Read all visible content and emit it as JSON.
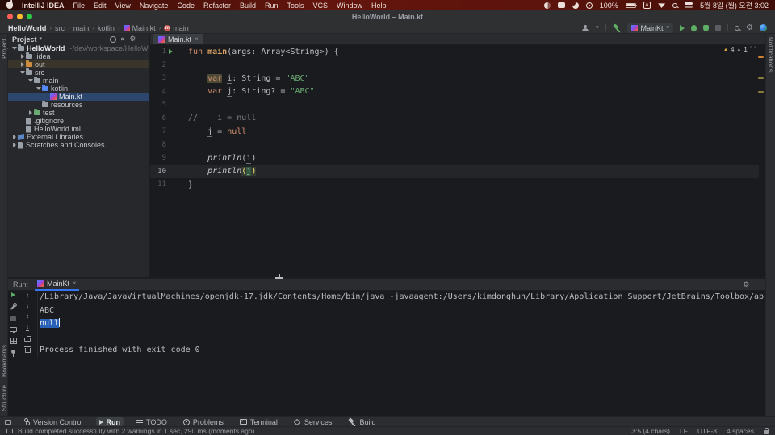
{
  "colors": {
    "accent": "#3674f0",
    "run_green": "#5fad65",
    "warning": "#d9a343",
    "error_stripe": "#cf8232",
    "selection_blue": "#2a62b8",
    "tree_selection": "#2d466e"
  },
  "menubar": {
    "items": [
      "IntelliJ IDEA",
      "File",
      "Edit",
      "View",
      "Navigate",
      "Code",
      "Refactor",
      "Build",
      "Run",
      "Tools",
      "VCS",
      "Window",
      "Help"
    ],
    "status": {
      "battery_percent": "100%",
      "input_source": "A",
      "clock": "5월 8일 (월) 오전 3:02"
    }
  },
  "window": {
    "title": "HelloWorld – Main.kt"
  },
  "toolbar": {
    "breadcrumbs": [
      {
        "label": "HelloWorld",
        "bold": true
      },
      {
        "label": "src"
      },
      {
        "label": "main"
      },
      {
        "label": "kotlin"
      },
      {
        "label": "Main.kt",
        "icon": "kotlin"
      },
      {
        "label": "main",
        "icon": "function"
      }
    ],
    "run_config": "MainKt"
  },
  "project": {
    "header": "Project",
    "tree": [
      {
        "label": "HelloWorld",
        "extra": "~/dev/workspace/HelloWorld",
        "indent": 0,
        "chevron": "v",
        "icon": "folder",
        "bold": true
      },
      {
        "label": ".idea",
        "indent": 1,
        "chevron": ">",
        "icon": "folder"
      },
      {
        "label": "out",
        "indent": 1,
        "chevron": ">",
        "icon": "folder-orange",
        "hl": true
      },
      {
        "label": "src",
        "indent": 1,
        "chevron": "v",
        "icon": "folder"
      },
      {
        "label": "main",
        "indent": 2,
        "chevron": "v",
        "icon": "folder"
      },
      {
        "label": "kotlin",
        "indent": 3,
        "chevron": "v",
        "icon": "folder-blue"
      },
      {
        "label": "Main.kt",
        "indent": 4,
        "chevron": "",
        "icon": "kotlin",
        "selected": true
      },
      {
        "label": "resources",
        "indent": 3,
        "chevron": "",
        "icon": "folder"
      },
      {
        "label": "test",
        "indent": 2,
        "chevron": ">",
        "icon": "folder-green"
      },
      {
        "label": ".gitignore",
        "indent": 1,
        "chevron": "",
        "icon": "file"
      },
      {
        "label": "HelloWorld.iml",
        "indent": 1,
        "chevron": "",
        "icon": "file"
      },
      {
        "label": "External Libraries",
        "indent": 0,
        "chevron": ">",
        "icon": "lib"
      },
      {
        "label": "Scratches and Consoles",
        "indent": 0,
        "chevron": ">",
        "icon": "file"
      }
    ]
  },
  "tabs": {
    "editor": "Main.kt"
  },
  "editor": {
    "warnings": {
      "major": "4",
      "minor": "1"
    },
    "lines": [
      {
        "run": true,
        "tokens": [
          [
            "fun ",
            "kw"
          ],
          [
            "main",
            "fn"
          ],
          [
            "(args: Array<String>) {",
            "pl"
          ]
        ]
      },
      {
        "tokens": []
      },
      {
        "tokens": [
          [
            "    ",
            "pl"
          ],
          [
            "var",
            "kw hlw"
          ],
          [
            " ",
            "pl"
          ],
          [
            "i",
            "vu"
          ],
          [
            ": String = ",
            "pl"
          ],
          [
            "\"ABC\"",
            "str"
          ]
        ]
      },
      {
        "tokens": [
          [
            "    ",
            "pl"
          ],
          [
            "var",
            "kw"
          ],
          [
            " ",
            "pl"
          ],
          [
            "j",
            "vu"
          ],
          [
            ": String? = ",
            "pl"
          ],
          [
            "\"ABC\"",
            "str"
          ]
        ]
      },
      {
        "tokens": []
      },
      {
        "tokens": [
          [
            "//    i = null",
            "cmt"
          ]
        ]
      },
      {
        "tokens": [
          [
            "    ",
            "pl"
          ],
          [
            "j",
            "vu"
          ],
          [
            " = ",
            "pl"
          ],
          [
            "null",
            "kw"
          ]
        ]
      },
      {
        "tokens": []
      },
      {
        "tokens": [
          [
            "    ",
            "pl"
          ],
          [
            "println",
            "fnc"
          ],
          [
            "(",
            "pl"
          ],
          [
            "i",
            "vu"
          ],
          [
            ")",
            "pl"
          ]
        ]
      },
      {
        "active": true,
        "tokens": [
          [
            "    ",
            "pl"
          ],
          [
            "println",
            "fnc"
          ],
          [
            "(",
            "ph"
          ],
          [
            "j",
            "vc"
          ],
          [
            ")",
            "ph"
          ]
        ]
      },
      {
        "tokens": [
          [
            "}",
            "pl"
          ]
        ]
      }
    ]
  },
  "run_panel": {
    "label": "Run:",
    "tab": "MainKt",
    "toolbar_main": [
      "rerun",
      "modify-run-configuration",
      "stop",
      "dump-threads",
      "restore-layout",
      "pin"
    ],
    "toolbar_console": [
      "up-stack-trace",
      "down-stack-trace",
      "soft-wrap",
      "scroll-to-end",
      "print",
      "clear-all"
    ],
    "console": [
      {
        "tokens": [
          [
            "/Library/Java/JavaVirtualMachines/openjdk-17.jdk/Contents/Home/bin/java -javaagent:/Users/kimdonghun/Library/Application Support/JetBrains/Toolbox/ap",
            "pl"
          ]
        ]
      },
      {
        "tokens": [
          [
            "ABC",
            "pl"
          ]
        ]
      },
      {
        "tokens": [
          [
            "null",
            "sel"
          ]
        ],
        "caret": true
      },
      {
        "tokens": []
      },
      {
        "tokens": [
          [
            "Process finished with exit code 0",
            "pl"
          ]
        ]
      }
    ]
  },
  "bottom_bar": {
    "items": [
      {
        "label": "Version Control",
        "icon": "branch"
      },
      {
        "label": "Run",
        "icon": "play",
        "active": true
      },
      {
        "label": "TODO",
        "icon": "todo"
      },
      {
        "label": "Problems",
        "icon": "problems"
      },
      {
        "label": "Terminal",
        "icon": "terminal"
      },
      {
        "label": "Services",
        "icon": "services"
      },
      {
        "label": "Build",
        "icon": "hammer"
      }
    ]
  },
  "status_bar": {
    "message": "Build completed successfully with 2 warnings in 1 sec, 290 ms (moments ago)",
    "caret": "3:5 (4 chars)",
    "line_sep": "LF",
    "encoding": "UTF-8",
    "indent": "4 spaces"
  },
  "stripes": {
    "left_top": "Project",
    "left_bottom": [
      "Bookmarks",
      "Structure"
    ],
    "right_top": "Notifications"
  }
}
